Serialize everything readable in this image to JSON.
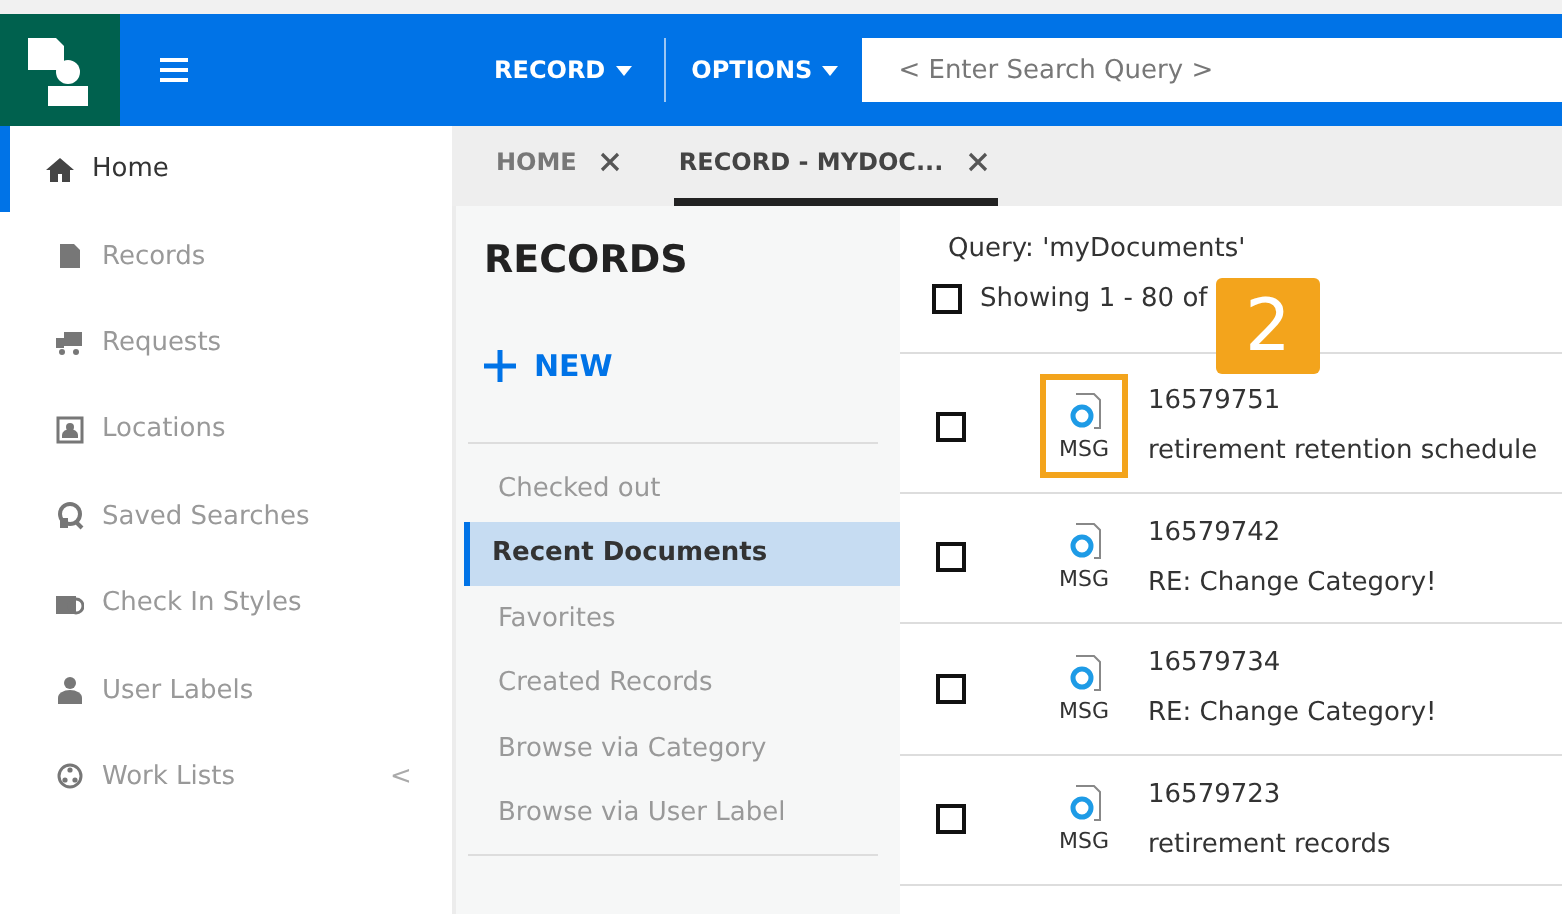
{
  "header": {
    "menus": [
      {
        "label": "RECORD"
      },
      {
        "label": "OPTIONS"
      }
    ],
    "search": {
      "placeholder": "< Enter Search Query >"
    }
  },
  "sidebar": {
    "items": [
      {
        "label": "Home",
        "selected": true
      },
      {
        "label": "Records",
        "selected": false
      },
      {
        "label": "Requests",
        "selected": false
      },
      {
        "label": "Locations",
        "selected": false
      },
      {
        "label": "Saved Searches",
        "selected": false
      },
      {
        "label": "Check In Styles",
        "selected": false
      },
      {
        "label": "User Labels",
        "selected": false
      },
      {
        "label": "Work Lists",
        "selected": false,
        "collapse": "<"
      }
    ]
  },
  "tabs": [
    {
      "label": "HOME",
      "selected": false
    },
    {
      "label": "RECORD - MYDOC...",
      "selected": true
    }
  ],
  "panel": {
    "title": "RECORDS",
    "new_button": "NEW",
    "items": [
      {
        "label": "Checked out",
        "selected": false
      },
      {
        "label": "Recent Documents",
        "selected": true
      },
      {
        "label": "Favorites",
        "selected": false
      },
      {
        "label": "Created Records",
        "selected": false
      },
      {
        "label": "Browse via Category",
        "selected": false
      },
      {
        "label": "Browse via User Label",
        "selected": false
      }
    ]
  },
  "results": {
    "query": "Query: 'myDocuments'",
    "showing": "Showing 1 - 80 of",
    "select_all_checked": false,
    "rows": [
      {
        "checked": false,
        "type": "MSG",
        "number": "16579751",
        "title": "retirement retention schedule",
        "highlighted": true
      },
      {
        "checked": false,
        "type": "MSG",
        "number": "16579742",
        "title": "RE: Change Category!",
        "highlighted": false
      },
      {
        "checked": false,
        "type": "MSG",
        "number": "16579734",
        "title": "RE: Change Category!",
        "highlighted": false
      },
      {
        "checked": false,
        "type": "MSG",
        "number": "16579723",
        "title": "retirement records",
        "highlighted": false
      }
    ]
  },
  "callout": {
    "number": "2"
  }
}
